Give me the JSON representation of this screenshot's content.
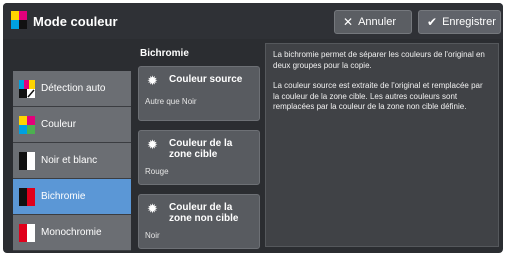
{
  "window": {
    "title": "Mode couleur",
    "cancel_label": "Annuler",
    "save_label": "Enregistrer"
  },
  "modes": [
    {
      "label": "Détection auto",
      "icon": "auto-detect-icon"
    },
    {
      "label": "Couleur",
      "icon": "color-icon"
    },
    {
      "label": "Noir et blanc",
      "icon": "black-white-icon"
    },
    {
      "label": "Bichromie",
      "icon": "two-color-icon",
      "selected": true
    },
    {
      "label": "Monochromie",
      "icon": "single-color-icon"
    }
  ],
  "bichromie": {
    "section_title": "Bichromie",
    "options": [
      {
        "label": "Couleur source",
        "value": "Autre que Noir"
      },
      {
        "label": "Couleur de la zone cible",
        "value": "Rouge"
      },
      {
        "label": "Couleur de la zone non cible",
        "value": "Noir"
      }
    ]
  },
  "info": {
    "paragraph1": "La bichromie permet de séparer les couleurs de l'original en deux groupes pour la copie.",
    "paragraph2": "La couleur source est extraite de l'original et remplacée par la couleur de la zone cible. Les autres couleurs sont remplacées par la couleur de la zone non cible définie."
  },
  "colors": {
    "selected": "#5b97d6",
    "background": "#2b2d31"
  }
}
